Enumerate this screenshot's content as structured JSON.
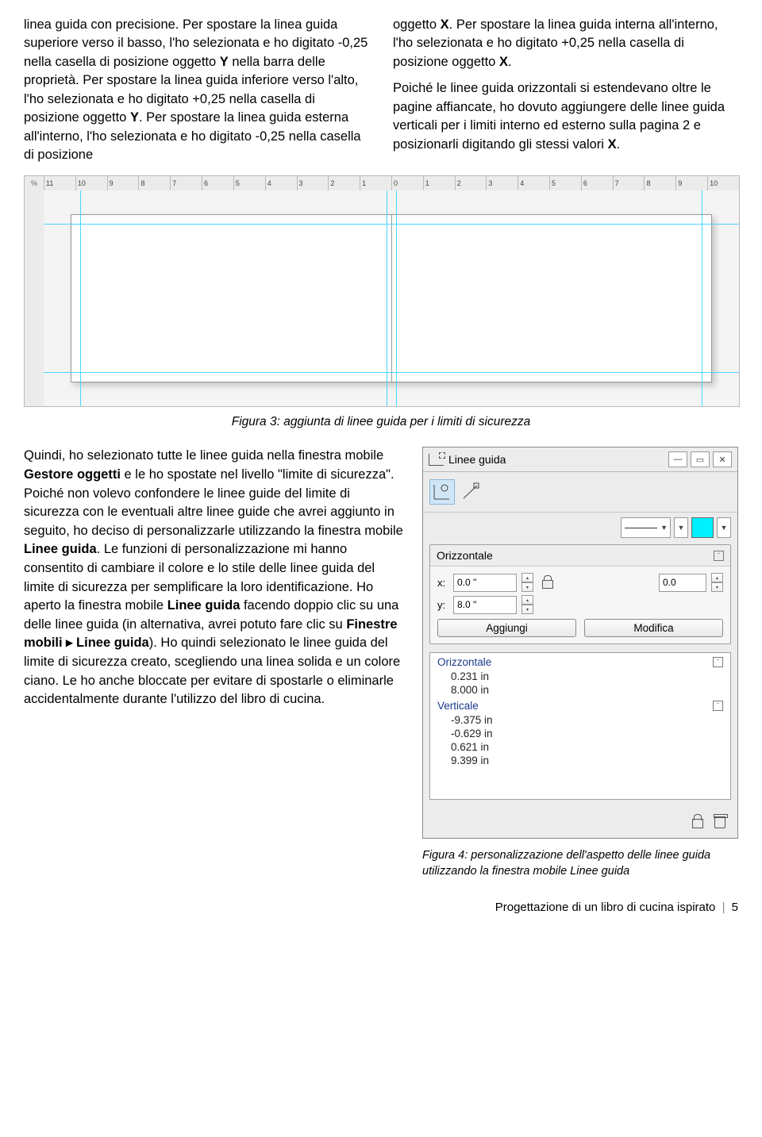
{
  "top_left_para": {
    "t1": "linea guida con precisione. Per spostare la linea guida superiore verso il basso, l'ho selezionata e ho digitato -0,25 nella casella di posizione oggetto ",
    "b1": "Y",
    "t2": " nella barra delle proprietà. Per spostare la linea guida inferiore verso l'alto, l'ho selezionata e ho digitato +0,25 nella casella di posizione oggetto ",
    "b2": "Y",
    "t3": ". Per spostare la linea guida esterna all'interno, l'ho selezionata e ho digitato -0,25 nella casella di posizione"
  },
  "top_right_para": {
    "t1": "oggetto ",
    "b1": "X",
    "t2": ". Per spostare la linea guida interna all'interno, l'ho selezionata e ho digitato +0,25 nella casella di posizione oggetto ",
    "b2": "X",
    "t3": ".",
    "p2a": "Poiché le linee guida orizzontali si estendevano oltre le pagine affiancate, ho dovuto aggiungere delle linee guida verticali per i limiti interno ed esterno sulla pagina 2 e posizionarli digitando gli stessi valori ",
    "p2b": "X",
    "p2c": "."
  },
  "ruler_corner": "%",
  "ruler_top": [
    "11",
    "10",
    "9",
    "8",
    "7",
    "6",
    "5",
    "4",
    "3",
    "2",
    "1",
    "0",
    "1",
    "2",
    "3",
    "4",
    "5",
    "6",
    "7",
    "8",
    "9",
    "10"
  ],
  "fig3_caption": "Figura 3: aggiunta di linee guida per i limiti di sicurezza",
  "bottom_para": {
    "t1": "Quindi, ho selezionato tutte le linee guida nella finestra mobile ",
    "b1": "Gestore oggetti",
    "t2": " e le ho spostate nel livello \"limite di sicurezza\". Poiché non volevo confondere le linee guide del limite di sicurezza con le eventuali altre linee guide che avrei aggiunto in seguito, ho deciso di personalizzarle utilizzando la finestra mobile ",
    "b2": "Linee guida",
    "t3": ". Le funzioni di personalizzazione mi hanno consentito di cambiare il colore e lo stile delle linee guida del limite di sicurezza per semplificare la loro identificazione. Ho aperto la finestra mobile ",
    "b3": "Linee guida",
    "t4": " facendo doppio clic su una delle linee guida (in alternativa, avrei potuto fare clic su ",
    "b4": "Finestre mobili",
    "arrow": " ▸ ",
    "b5": "Linee guida",
    "t5": "). Ho quindi selezionato le linee guida del limite di sicurezza creato, scegliendo una linea solida e un colore ciano. Le ho anche bloccate per evitare di spostarle o eliminarle accidentalmente durante l'utilizzo del libro di cucina."
  },
  "panel": {
    "title": "Linee guida",
    "section1_header": "Orizzontale",
    "x_label": "x:",
    "x_value": "0.0 \"",
    "y_label": "y:",
    "y_value": "8.0 \"",
    "angle_value": "0.0",
    "btn_add": "Aggiungi",
    "btn_edit": "Modifica",
    "list_h_header": "Orizzontale",
    "list_h": [
      "0.231 in",
      "8.000 in"
    ],
    "list_v_header": "Verticale",
    "list_v": [
      "-9.375 in",
      "-0.629 in",
      "0.621 in",
      "9.399 in"
    ]
  },
  "fig4_caption": "Figura 4: personalizzazione dell'aspetto delle linee guida utilizzando la finestra mobile Linee guida",
  "footer_text": "Progettazione di un libro di cucina ispirato",
  "footer_page": "5"
}
